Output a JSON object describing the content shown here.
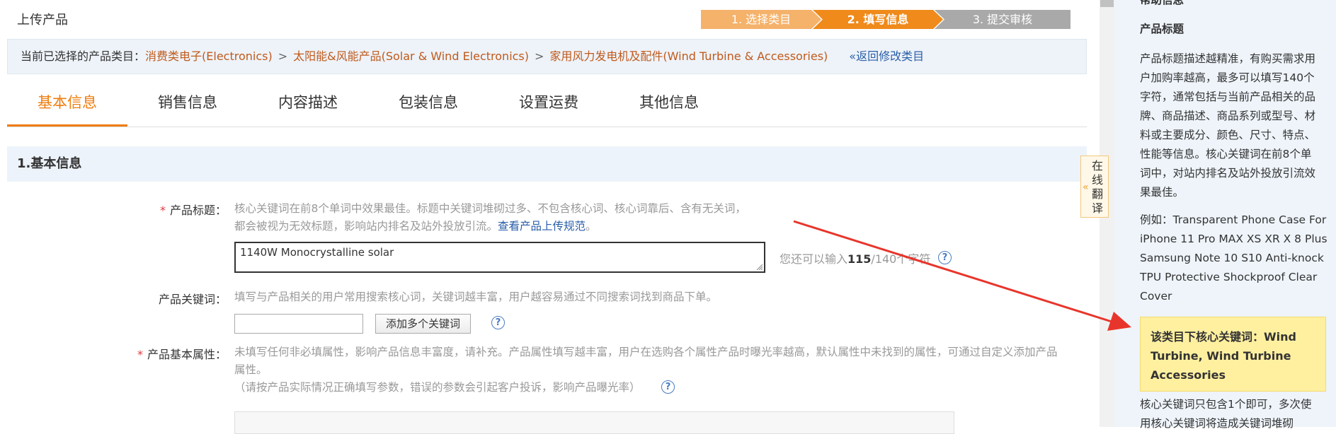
{
  "header": {
    "title": "上传产品",
    "steps": [
      "1. 选择类目",
      "2. 填写信息",
      "3. 提交审核"
    ]
  },
  "category_bar": {
    "prefix": "当前已选择的产品类目：",
    "path": [
      "消费类电子(Electronics)",
      "太阳能&风能产品(Solar & Wind Electronics)",
      "家用风力发电机及配件(Wind Turbine & Accessories)"
    ],
    "separator": ">",
    "back_link": "«返回修改类目"
  },
  "tabs": [
    "基本信息",
    "销售信息",
    "内容描述",
    "包装信息",
    "设置运费",
    "其他信息"
  ],
  "section": {
    "title": "1.基本信息"
  },
  "product_title": {
    "required": "*",
    "label": "产品标题：",
    "hint_line1": "核心关键词在前8个单词中效果最佳。标题中关键词堆砌过多、不包含核心词、核心词靠后、含有无关词，",
    "hint_line2": "都会被视为无效标题，影响站内排名及站外投放引流。",
    "hint_link": "查看产品上传规范",
    "hint_end": "。",
    "value": "1140W Monocrystalline solar",
    "counter_prefix": "您还可以输入",
    "counter_remaining": "115",
    "counter_total": "/140个字符",
    "help": "?"
  },
  "keywords": {
    "label": "产品关键词：",
    "hint": "填写与产品相关的用户常用搜索核心词，关键词越丰富，用户越容易通过不同搜索词找到商品下单。",
    "input_value": "",
    "add_button": "添加多个关键词",
    "help": "?"
  },
  "attributes": {
    "required": "*",
    "label": "产品基本属性：",
    "hint_line1": "未填写任何非必填属性，影响产品信息丰富度，请补充。产品属性填写越丰富，用户在选购各个属性产品时曝光率越高，默认属性中未找到的属性，可通过自定义添加产品",
    "hint_line2": "属性。",
    "hint_line3": "（请按产品实际情况正确填写参数，错误的参数会引起客户投诉，影响产品曝光率）",
    "help": "?"
  },
  "translate_tab": {
    "chevron": "«",
    "label": "在线翻译"
  },
  "help_panel": {
    "top_cut": "帮助信息",
    "heading": "产品标题",
    "paragraph": [
      "产品标题描述越精准，有购买需求用",
      "户加购率越高，最多可以填写140个",
      "字符，通常包括与当前产品相关的品",
      "牌、商品描述、商品系列或型号、材",
      "料或主要成分、颜色、尺寸、特点、",
      "性能等信息。核心关键词在前8个单",
      "词中，对站内排名及站外投放引流效",
      "果最佳。"
    ],
    "example": [
      "例如：Transparent Phone Case For",
      "iPhone 11 Pro MAX XS XR X 8 Plus",
      "Samsung Note 10 S10 Anti-knock",
      "TPU Protective Shockproof Clear",
      "Cover"
    ],
    "highlight": [
      "该类目下核心关键词：Wind",
      "Turbine, Wind Turbine",
      "Accessories"
    ],
    "bottom": [
      "核心关键词只包含1个即可，多次使",
      "用核心关键词将造成关键词堆砌"
    ]
  },
  "colors": {
    "accent": "#ef7d0e",
    "link": "#2a5ea8",
    "category": "#c05a1c",
    "arrow": "#e8352b"
  }
}
